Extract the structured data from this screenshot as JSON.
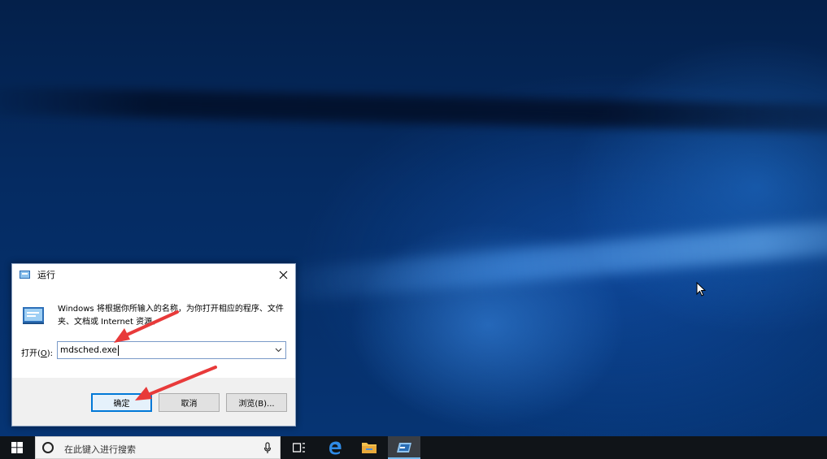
{
  "dialog": {
    "title": "运行",
    "description": "Windows 将根据你所输入的名称，为你打开相应的程序、文件夹、文档或 Internet 资源。",
    "open_label": "打开(",
    "open_accel": "O",
    "open_label_end": "):",
    "input_value": "mdsched.exe",
    "ok_label": "确定",
    "cancel_label": "取消",
    "browse_label": "浏览(B)..."
  },
  "taskbar": {
    "search_placeholder": "在此键入进行搜索",
    "icons": [
      "windows-logo-icon",
      "task-view-icon",
      "edge-icon",
      "file-explorer-icon",
      "run-icon"
    ]
  },
  "colors": {
    "accent": "#0078d7",
    "arrow": "#e83a3a",
    "taskbar": "#101418"
  }
}
